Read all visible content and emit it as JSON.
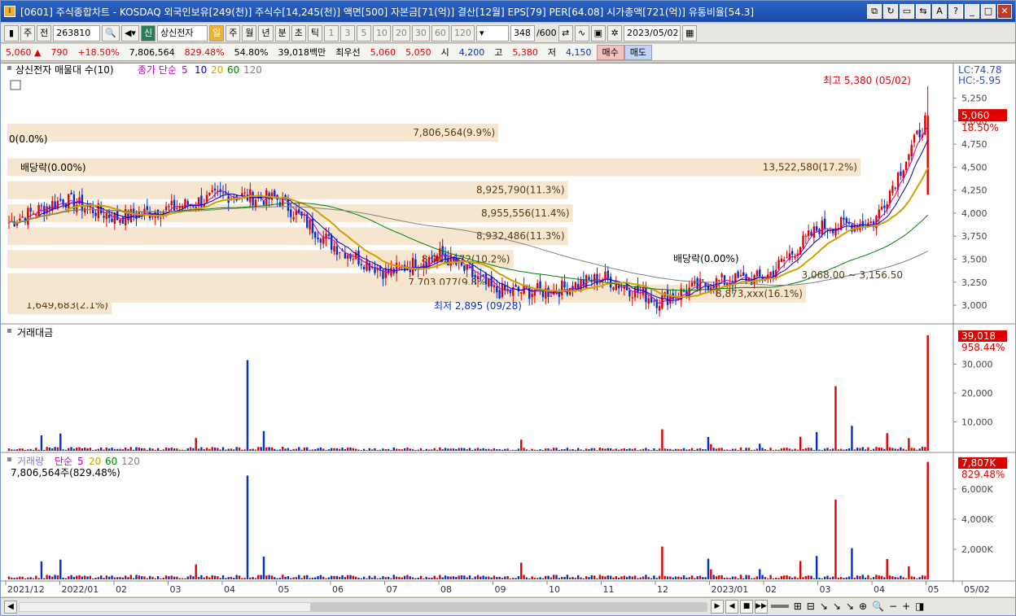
{
  "window": {
    "title": "[0601] 주식종합차트 - KOSDAQ 외국인보유[249(천)] 주식수[14,245(천)] 액면[500] 자본금[71(억)] 결산[12월] EPS[79] PER[64.08] 시가총액[721(억)] 유통비율[54.3]",
    "buttons": [
      "⧉",
      "↻",
      "▭",
      "⇆",
      "A",
      "?",
      "_",
      "□",
      "✕"
    ]
  },
  "toolbar": {
    "period_select": "주",
    "prev_label": "전",
    "code_value": "263810",
    "stock_name": "상신전자",
    "stock_badge": "신",
    "interval_labels": [
      "일",
      "주",
      "월",
      "년",
      "분",
      "초",
      "틱"
    ],
    "minute_labels": [
      "1",
      "3",
      "5",
      "10",
      "20",
      "30",
      "60",
      "120"
    ],
    "count_value": "348",
    "count_total": "/600",
    "date_value": "2023/05/02"
  },
  "quote": {
    "price": "5,060",
    "change": "790",
    "change_rate": "+18.50%",
    "volume": "7,806,564",
    "volume_rate": "829.48%",
    "turnover": "54.80%",
    "amount": "39,018백만",
    "best_ask_label": "최우선",
    "best_ask": "5,060",
    "best_bid": "5,050",
    "open_label": "시",
    "open": "4,200",
    "high_label": "고",
    "high": "5,380",
    "low_label": "저",
    "low": "4,150",
    "buy_label": "매수",
    "sell_label": "매도"
  },
  "price_panel": {
    "title": "상신전자 매물대 수(10)",
    "ma_legend_label": "종가 단순",
    "ma_periods": [
      "5",
      "10",
      "20",
      "60",
      "120"
    ],
    "ma_colors": {
      "5": "#c000c0",
      "10": "#0000c0",
      "20": "#d0a000",
      "60": "#008000",
      "120": "#808080"
    },
    "right_info": [
      "LC:74.78",
      "HC:-5.95"
    ],
    "current_price_badge": "5,060",
    "current_rate": "18.50%",
    "high_marker": "최고 5,380 (05/02)",
    "low_marker": "최저 2,895 (09/28)",
    "dividend_labels": [
      "배당락(0.00%)",
      "배당락(0.00%)"
    ],
    "zero_label": "0(0.0%)",
    "range_label": "3,068.00 ~ 3,156.50",
    "y_ticks": [
      "5,250",
      "5,000",
      "4,750",
      "4,500",
      "4,250",
      "4,000",
      "3,750",
      "3,500",
      "3,250",
      "3,000"
    ],
    "volume_profile": [
      {
        "label": "1,649,683(2.1%)",
        "price": 3000
      },
      {
        "label": "7,703,077(9.8%)",
        "price": 3250
      },
      {
        "label": "8,042,672(10.2%)",
        "price": 3500
      },
      {
        "label": "8,932,486(11.3%)",
        "price": 3750
      },
      {
        "label": "8,955,556(11.4%)",
        "price": 4000
      },
      {
        "label": "8,925,790(11.3%)",
        "price": 4250
      },
      {
        "label": "13,522,580(17.2%)",
        "price": 4500
      },
      {
        "label": "7,806,564(9.9%)",
        "price": 4875
      },
      {
        "label": "8,873,xxx(16.1%)",
        "price": 3125
      }
    ]
  },
  "amount_panel": {
    "title": "거래대금",
    "badge": "39,018",
    "rate": "958.44%",
    "y_ticks": [
      "30,000",
      "20,000",
      "10,000"
    ]
  },
  "volume_panel": {
    "title": "거래량",
    "ma_label": "단순",
    "ma_periods": [
      "5",
      "20",
      "60",
      "120"
    ],
    "summary": "7,806,564주(829.48%)",
    "badge": "7,807K",
    "rate": "829.48%",
    "y_ticks": [
      "6,000K",
      "4,000K",
      "2,000K"
    ]
  },
  "x_axis": [
    "2021/12",
    "2022/01",
    "02",
    "03",
    "04",
    "05",
    "06",
    "07",
    "08",
    "09",
    "10",
    "11",
    "12",
    "2023/01",
    "02",
    "03",
    "04",
    "05",
    "05/02"
  ],
  "bottom": {
    "nav": [
      "▶",
      "◀",
      "■",
      "▶▶"
    ],
    "zoom": [
      "−",
      "+"
    ]
  },
  "chart_data": {
    "type": "candlestick",
    "period": "daily",
    "high": {
      "price": 5380,
      "date": "05/02"
    },
    "low": {
      "price": 2895,
      "date": "09/28"
    },
    "last_close": 5060,
    "ylim": [
      2850,
      5450
    ],
    "monthly_close_approx": [
      {
        "month": "2021/12",
        "close": 3900
      },
      {
        "month": "2022/01",
        "close": 4150
      },
      {
        "month": "02",
        "close": 3950
      },
      {
        "month": "03",
        "close": 4050
      },
      {
        "month": "04",
        "close": 4200
      },
      {
        "month": "05",
        "close": 4150
      },
      {
        "month": "06",
        "close": 3650
      },
      {
        "month": "07",
        "close": 3350
      },
      {
        "month": "08",
        "close": 3550
      },
      {
        "month": "09",
        "close": 3150
      },
      {
        "month": "10",
        "close": 3150
      },
      {
        "month": "11",
        "close": 3300
      },
      {
        "month": "12",
        "close": 3050
      },
      {
        "month": "2023/01",
        "close": 3250
      },
      {
        "month": "02",
        "close": 3300
      },
      {
        "month": "03",
        "close": 3850
      },
      {
        "month": "04",
        "close": 3900
      },
      {
        "month": "05",
        "close": 5060
      }
    ]
  }
}
